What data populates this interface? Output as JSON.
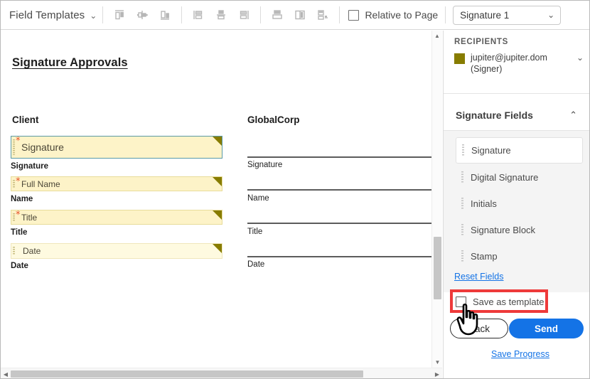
{
  "toolbar": {
    "field_templates_label": "Field Templates",
    "dropdown_caret": "⌄",
    "align_icons": [
      {
        "name": "align-top-icon"
      },
      {
        "name": "align-middle-horizontal-icon"
      },
      {
        "name": "align-bottom-icon"
      },
      {
        "name": "align-left-icon"
      },
      {
        "name": "align-center-vertical-icon"
      },
      {
        "name": "align-right-icon"
      },
      {
        "name": "distribute-horizontal-icon"
      },
      {
        "name": "match-width-icon"
      },
      {
        "name": "match-size-icon"
      }
    ],
    "relative_to_page_label": "Relative to Page",
    "relative_to_page_checked": false,
    "signature_select_value": "Signature 1",
    "select_caret": "⌄"
  },
  "document": {
    "title": "Signature Approvals",
    "left_column_heading": "Client",
    "right_column_heading": "GlobalCorp",
    "fields": [
      {
        "placeholder": "Signature",
        "label": "Signature",
        "required": true,
        "selected": true
      },
      {
        "placeholder": "Full Name",
        "label": "Name",
        "required": true,
        "selected": false
      },
      {
        "placeholder": "Title",
        "label": "Title",
        "required": true,
        "selected": false
      },
      {
        "placeholder": "Date",
        "label": "Date",
        "required": false,
        "selected": false
      }
    ],
    "right_labels": [
      "Signature",
      "Name",
      "Title",
      "Date"
    ],
    "required_marker": "*"
  },
  "scrollbars": {
    "vertical_up_arrow": "▲",
    "vertical_down_arrow": "▼",
    "horizontal_left_arrow": "◀",
    "horizontal_right_arrow": "▶"
  },
  "panel": {
    "recipients_heading": "RECIPIENTS",
    "recipient_email": "jupiter@jupiter.dom",
    "recipient_role": "(Signer)",
    "recipient_color": "#877c00",
    "recipient_caret": "⌄",
    "signature_fields_title": "Signature Fields",
    "signature_fields_caret": "⌃",
    "field_items": [
      {
        "label": "Signature",
        "active": true
      },
      {
        "label": "Digital Signature",
        "active": false
      },
      {
        "label": "Initials",
        "active": false
      },
      {
        "label": "Signature Block",
        "active": false
      },
      {
        "label": "Stamp",
        "active": false
      }
    ],
    "reset_fields_label": "Reset Fields",
    "save_as_template_label": "Save as template",
    "save_as_template_checked": false,
    "back_label": "Back",
    "send_label": "Send",
    "save_progress_label": "Save Progress",
    "accent_blue": "#1473e6",
    "annotation_color": "#ee3a3a"
  }
}
